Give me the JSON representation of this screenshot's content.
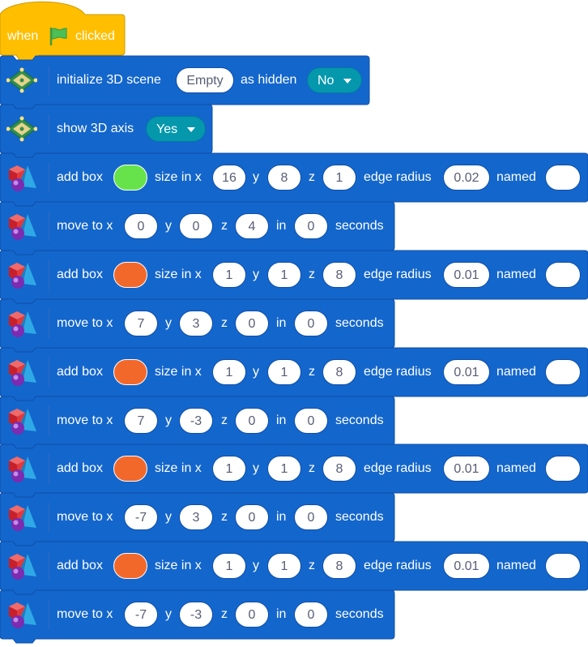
{
  "hat": {
    "when": "when",
    "clicked": "clicked",
    "flag_icon": "green-flag-icon"
  },
  "init_block": {
    "label": "initialize 3D scene",
    "scene_value": "Empty",
    "hidden_label": "as hidden",
    "hidden_value": "No"
  },
  "axis_block": {
    "label": "show 3D axis",
    "value": "Yes"
  },
  "labels": {
    "add_box": "add box",
    "size_in_x": "size in x",
    "y": "y",
    "z": "z",
    "edge_radius": "edge radius",
    "named": "named",
    "move_to_x": "move to x",
    "in": "in",
    "seconds": "seconds"
  },
  "colors": {
    "green": "#66e24a",
    "orange": "#f2682b",
    "block_blue": "#1366cc",
    "block_dark": "#0f4fa8",
    "hat_yellow": "#ffbf00"
  },
  "boxes": [
    {
      "color": "#66e24a",
      "x": "16",
      "y": "8",
      "z": "1",
      "radius": "0.02",
      "name": ""
    },
    {
      "color": "#f2682b",
      "x": "1",
      "y": "1",
      "z": "8",
      "radius": "0.01",
      "name": ""
    },
    {
      "color": "#f2682b",
      "x": "1",
      "y": "1",
      "z": "8",
      "radius": "0.01",
      "name": ""
    },
    {
      "color": "#f2682b",
      "x": "1",
      "y": "1",
      "z": "8",
      "radius": "0.01",
      "name": ""
    },
    {
      "color": "#f2682b",
      "x": "1",
      "y": "1",
      "z": "8",
      "radius": "0.01",
      "name": ""
    }
  ],
  "moves": [
    {
      "x": "0",
      "y": "0",
      "z": "4",
      "t": "0"
    },
    {
      "x": "7",
      "y": "3",
      "z": "0",
      "t": "0"
    },
    {
      "x": "7",
      "y": "-3",
      "z": "0",
      "t": "0"
    },
    {
      "x": "-7",
      "y": "3",
      "z": "0",
      "t": "0"
    },
    {
      "x": "-7",
      "y": "-3",
      "z": "0",
      "t": "0"
    }
  ]
}
